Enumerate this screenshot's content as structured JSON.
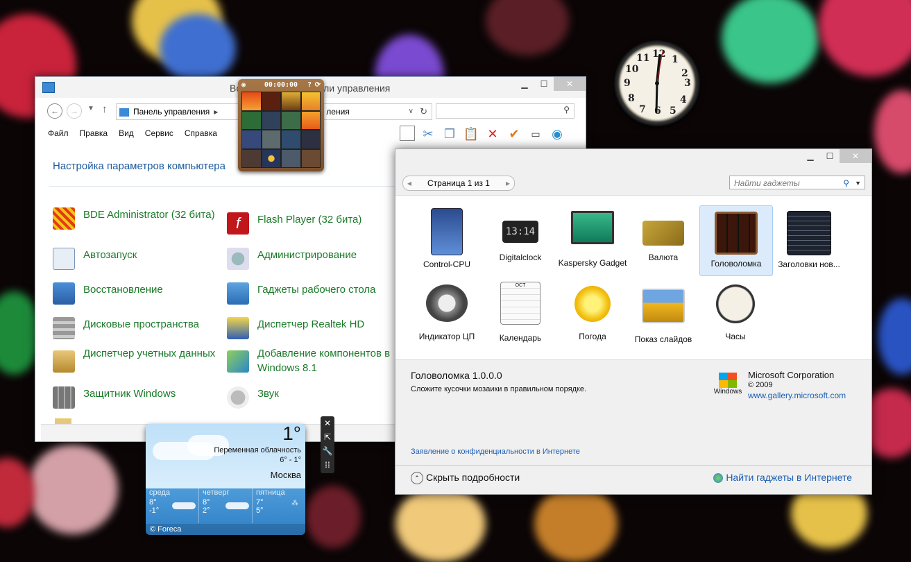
{
  "control_panel": {
    "title": "Все элементы панели управления",
    "title_visible": "Во",
    "title_right": "ли управления",
    "address": "Панель управления",
    "address_segment2": "ления",
    "menu": [
      "Файл",
      "Правка",
      "Вид",
      "Сервис",
      "Справка"
    ],
    "heading": "Настройка параметров компьютера",
    "items": [
      "BDE Administrator (32 бита)",
      "Flash Player (32 бита)",
      "Автозапуск",
      "Администрирование",
      "Восстановление",
      "Гаджеты рабочего стола",
      "Дисковые пространства",
      "Диспетчер Realtek HD",
      "Диспетчер учетных данных",
      "Добавление компонентов в Windows 8.1",
      "Защитник Windows",
      "Звук"
    ]
  },
  "puzzle_gadget": {
    "timer": "00:00:00",
    "help": "?"
  },
  "gadgets_window": {
    "pager": "Страница 1 из 1",
    "search_placeholder": "Найти гаджеты",
    "gadgets": [
      "Control-CPU",
      "Digitalclock",
      "Kaspersky Gadget",
      "Валюта",
      "Головоломка",
      "Заголовки нов...",
      "Индикатор ЦП",
      "Календарь",
      "Погода",
      "Показ слайдов",
      "Часы"
    ],
    "selected": "Головоломка",
    "detail_title": "Головоломка 1.0.0.0",
    "detail_desc": "Сложите кусочки мозаики в правильном порядке.",
    "publisher": "Microsoft Corporation",
    "copyright": "© 2009",
    "publisher_url": "www.gallery.microsoft.com",
    "windows_logo_text": "Windows",
    "privacy_link": "Заявление о конфиденциальности в Интернете",
    "hide_details": "Скрыть подробности",
    "find_online": "Найти гаджеты в Интернете",
    "digitalclock_time": "13:14",
    "calendar_month": "OCT"
  },
  "weather_gadget": {
    "temperature": "1°",
    "condition": "Переменная облачность",
    "range": "6° - 1°",
    "city": "Москва",
    "forecast": [
      {
        "day": "среда",
        "high": "8°",
        "low": "-1°"
      },
      {
        "day": "четверг",
        "high": "8°",
        "low": "2°"
      },
      {
        "day": "пятница",
        "high": "7°",
        "low": "5°"
      }
    ],
    "credit": "© Foreca"
  },
  "clock_numbers": [
    "12",
    "1",
    "2",
    "3",
    "4",
    "5",
    "6",
    "7",
    "8",
    "9",
    "10",
    "11"
  ],
  "colors": {
    "link_blue": "#1a5eb5",
    "cp_green": "#1a7a28",
    "heading_blue": "#1e5b9e",
    "selection": "#dcebfb"
  }
}
